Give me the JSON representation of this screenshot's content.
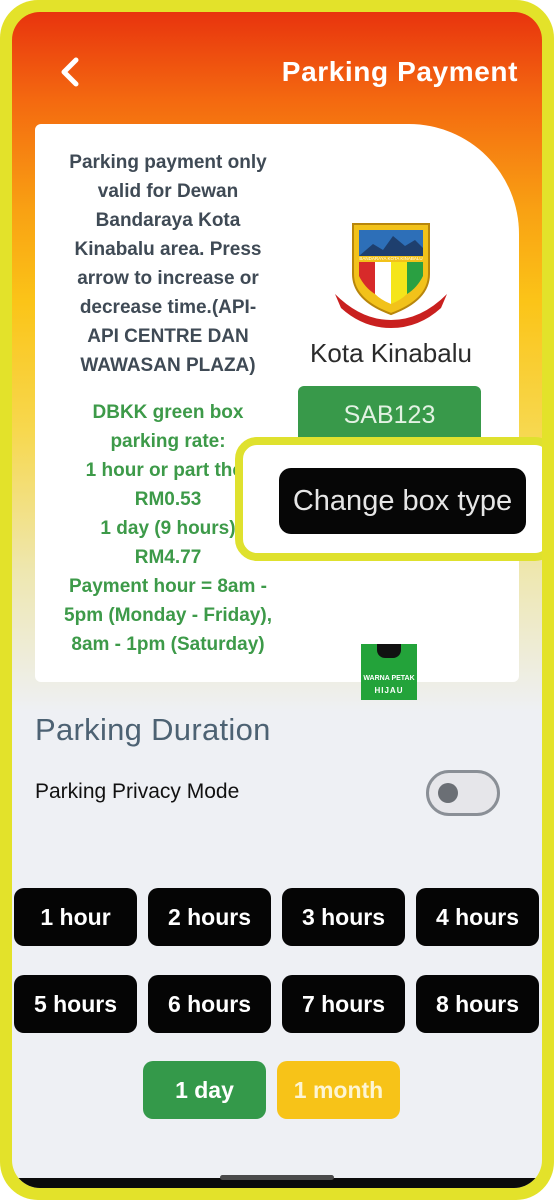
{
  "header": {
    "title": "Parking Payment",
    "back_icon": "chevron-left-icon"
  },
  "info": {
    "description_lines": [
      "Parking payment only",
      "valid for Dewan",
      "Bandaraya Kota",
      "Kinabalu area. Press",
      "arrow to increase or",
      "decrease time.(API-",
      "API CENTRE DAN",
      "WAWASAN PLAZA)"
    ],
    "rate_lines": [
      "DBKK green box",
      "parking rate:",
      "1 hour or part ther",
      "RM0.53",
      "1 day (9 hours)",
      "RM4.77",
      "Payment hour = 8am -",
      "5pm (Monday - Friday),",
      "8am - 1pm (Saturday)"
    ],
    "logo_text": "BANDARAYA KOTA KINABALU",
    "city_name": "Kota Kinabalu",
    "plate_number": "SAB123",
    "box_sign_line1": "WARNA PETAK",
    "box_sign_line2": "HIJAU"
  },
  "popup": {
    "change_box_label": "Change box type"
  },
  "duration": {
    "title": "Parking Duration",
    "privacy_label": "Parking Privacy Mode",
    "privacy_enabled": false,
    "options": [
      "1 hour",
      "2 hours",
      "3 hours",
      "4 hours",
      "5 hours",
      "6 hours",
      "7 hours",
      "8 hours"
    ],
    "day_label": "1 day",
    "month_label": "1 month"
  },
  "colors": {
    "header_gradient_top": "#e8340e",
    "header_gradient_mid": "#f9a213",
    "rate_text": "#3d9a49",
    "plate_bg": "#38994a",
    "day_button": "#34994a",
    "month_button": "#f7c318",
    "highlight_border": "#dfe12e",
    "duration_button": "#050505"
  }
}
